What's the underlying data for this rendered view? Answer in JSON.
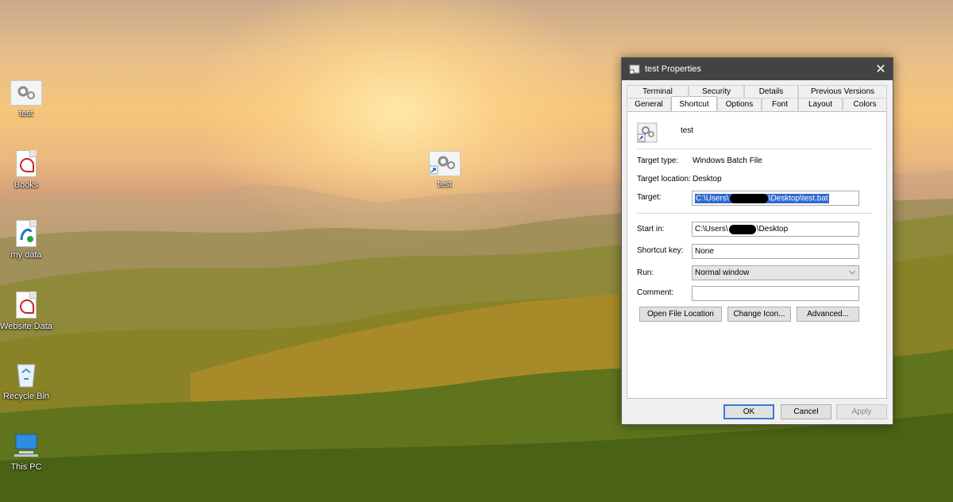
{
  "desktop": {
    "icons": [
      {
        "label": "test",
        "icon": "batch-file-icon"
      },
      {
        "label": "Books",
        "icon": "pdf-document-icon"
      },
      {
        "label": "my data",
        "icon": "doc-shortcut-icon"
      },
      {
        "label": "Website Data",
        "icon": "pdf-document-icon"
      },
      {
        "label": "Recycle Bin",
        "icon": "recycle-bin-icon"
      },
      {
        "label": "This PC",
        "icon": "computer-icon"
      }
    ],
    "center_icon": {
      "label": "test",
      "icon": "batch-shortcut-icon"
    }
  },
  "dialog": {
    "title": "test Properties",
    "close_glyph": "✕",
    "tabs_top": [
      "Terminal",
      "Security",
      "Details",
      "Previous Versions"
    ],
    "tabs_bottom": [
      "General",
      "Shortcut",
      "Options",
      "Font",
      "Layout",
      "Colors"
    ],
    "active_tab": "Shortcut",
    "name": "test",
    "target_type_label": "Target type:",
    "target_type_value": "Windows Batch File",
    "target_location_label": "Target location:",
    "target_location_value": "Desktop",
    "target_label": "Target:",
    "target_value_prefix": "C:\\Users\\",
    "target_value_suffix": "\\Desktop\\test.bat",
    "start_in_label": "Start in:",
    "start_in_prefix": "C:\\Users\\",
    "start_in_suffix": "\\Desktop",
    "shortcut_key_label": "Shortcut key:",
    "shortcut_key_value": "None",
    "run_label": "Run:",
    "run_value": "Normal window",
    "comment_label": "Comment:",
    "comment_value": "",
    "open_file_location_button": "Open File Location",
    "change_icon_button": "Change Icon...",
    "advanced_button": "Advanced...",
    "ok_button": "OK",
    "cancel_button": "Cancel",
    "apply_button": "Apply"
  },
  "colors": {
    "titlebar": "#434343",
    "selection": "#2e6ad0",
    "ok_border": "#3c7ad6"
  }
}
